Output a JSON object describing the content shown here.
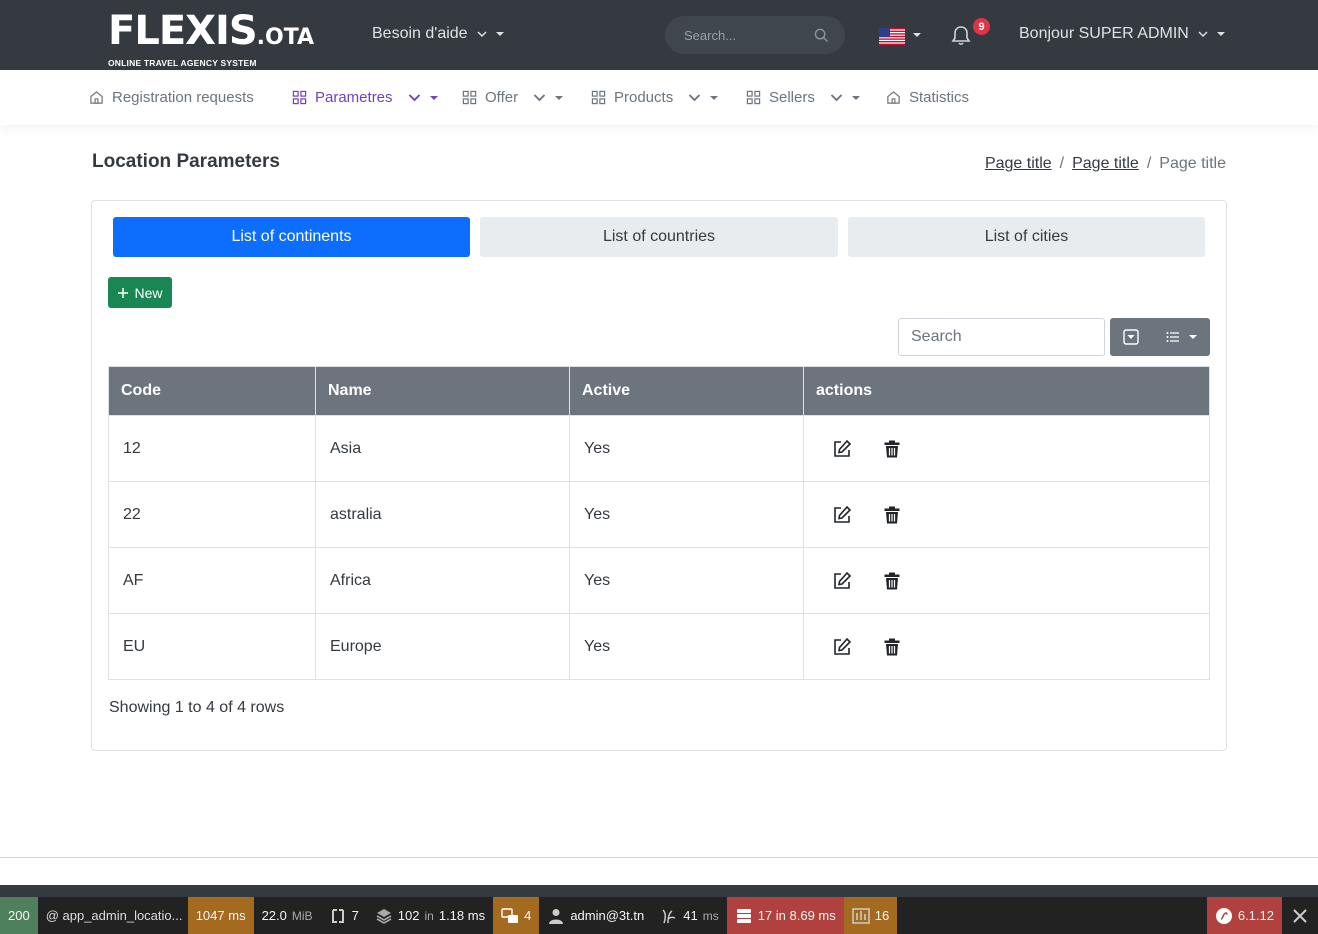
{
  "topbar": {
    "logo_main": "FLEXIS",
    "logo_ota": ".OTA",
    "logo_sub": "ONLINE TRAVEL AGENCY SYSTEM",
    "help_label": "Besoin d'aide",
    "search_placeholder": "Search...",
    "flag": "us-flag-icon",
    "notifications_count": "9",
    "user_greeting": "Bonjour SUPER ADMIN"
  },
  "nav": {
    "items": [
      {
        "label": "Registration requests",
        "icon": "home-icon",
        "dropdown": false
      },
      {
        "label": "Parametres",
        "icon": "grid-icon",
        "dropdown": true,
        "active": true
      },
      {
        "label": "Offer",
        "icon": "grid-icon",
        "dropdown": true
      },
      {
        "label": "Products",
        "icon": "grid-icon",
        "dropdown": true
      },
      {
        "label": "Sellers",
        "icon": "grid-icon",
        "dropdown": true
      },
      {
        "label": "Statistics",
        "icon": "home-icon",
        "dropdown": false
      }
    ]
  },
  "page": {
    "title": "Location Parameters",
    "breadcrumb": [
      "Page title",
      "Page title",
      "Page title"
    ]
  },
  "tabs": [
    "List of continents",
    "List of countries",
    "List of cities"
  ],
  "new_button": "New",
  "table": {
    "search_placeholder": "Search",
    "columns": [
      "Code",
      "Name",
      "Active",
      "actions"
    ],
    "rows": [
      {
        "code": "12",
        "name": "Asia",
        "active": "Yes"
      },
      {
        "code": "22",
        "name": "astralia",
        "active": "Yes"
      },
      {
        "code": "AF",
        "name": "Africa",
        "active": "Yes"
      },
      {
        "code": "EU",
        "name": "Europe",
        "active": "Yes"
      }
    ],
    "footer": "Showing 1 to 4 of 4 rows"
  },
  "debugbar": {
    "status": "200",
    "route": "@ app_admin_locatio...",
    "time": "1047 ms",
    "memory": "22.0",
    "memory_unit": "MiB",
    "forms": "7",
    "cache_count": "102",
    "cache_in": "in",
    "cache_time": "1.18 ms",
    "translations": "4",
    "user": "admin@3t.tn",
    "twig": "41",
    "twig_unit": "ms",
    "db": "17 in 8.69 ms",
    "events": "16",
    "symfony_version": "6.1.12",
    "colors": {
      "green": "#4f805d",
      "orange": "#a46a1f",
      "red": "#b0413e"
    }
  }
}
